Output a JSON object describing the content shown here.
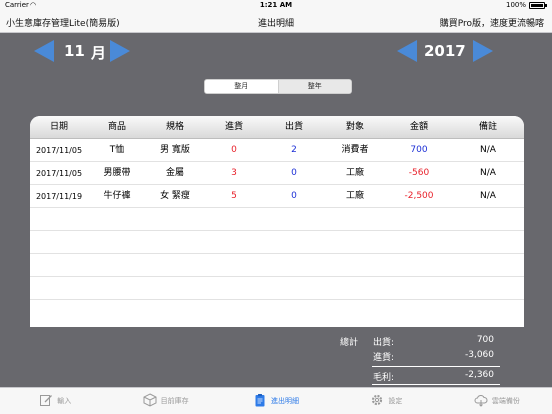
{
  "status": {
    "carrier": "Carrier",
    "wifi": "◠",
    "time": "1:21 AM",
    "battery": "100%"
  },
  "nav": {
    "app_title": "小生意庫存管理Lite(簡易版)",
    "page_title": "進出明細",
    "upgrade": "購買Pro版，速度更流暢喀"
  },
  "period": {
    "month": "11",
    "month_unit": "月",
    "year": "2017"
  },
  "segments": [
    "整月",
    "整年"
  ],
  "table": {
    "headers": [
      "日期",
      "商品",
      "規格",
      "進貨",
      "出貨",
      "對象",
      "金額",
      "備註"
    ],
    "rows": [
      [
        "2017/11/05",
        "T恤",
        "男 寬版",
        "0",
        "2",
        "消費者",
        "700",
        "N/A"
      ],
      [
        "2017/11/05",
        "男腰帶",
        "金屬",
        "3",
        "0",
        "工廠",
        "-560",
        "N/A"
      ],
      [
        "2017/11/19",
        "牛仔褲",
        "女 緊瘦",
        "5",
        "0",
        "工廠",
        "-2,500",
        "N/A"
      ]
    ],
    "empty_rows": 5
  },
  "totals": {
    "label": "總計",
    "out_label": "出貨:",
    "out_value": "700",
    "in_label": "進貨:",
    "in_value": "-3,060",
    "profit_label": "毛利:",
    "profit_value": "-2,360"
  },
  "tabs": [
    {
      "label": "輸入",
      "icon": "edit-icon",
      "active": false
    },
    {
      "label": "目前庫存",
      "icon": "box-icon",
      "active": false
    },
    {
      "label": "進出明細",
      "icon": "clipboard-icon",
      "active": true
    },
    {
      "label": "設定",
      "icon": "gear-icon",
      "active": false
    },
    {
      "label": "雲端備份",
      "icon": "cloud-icon",
      "active": false
    }
  ],
  "colors": {
    "accent": "#2e7be8",
    "arrow": "#4a8ad8",
    "positive": "#1c2fd6",
    "negative": "#e8202a",
    "background": "#68686d"
  }
}
